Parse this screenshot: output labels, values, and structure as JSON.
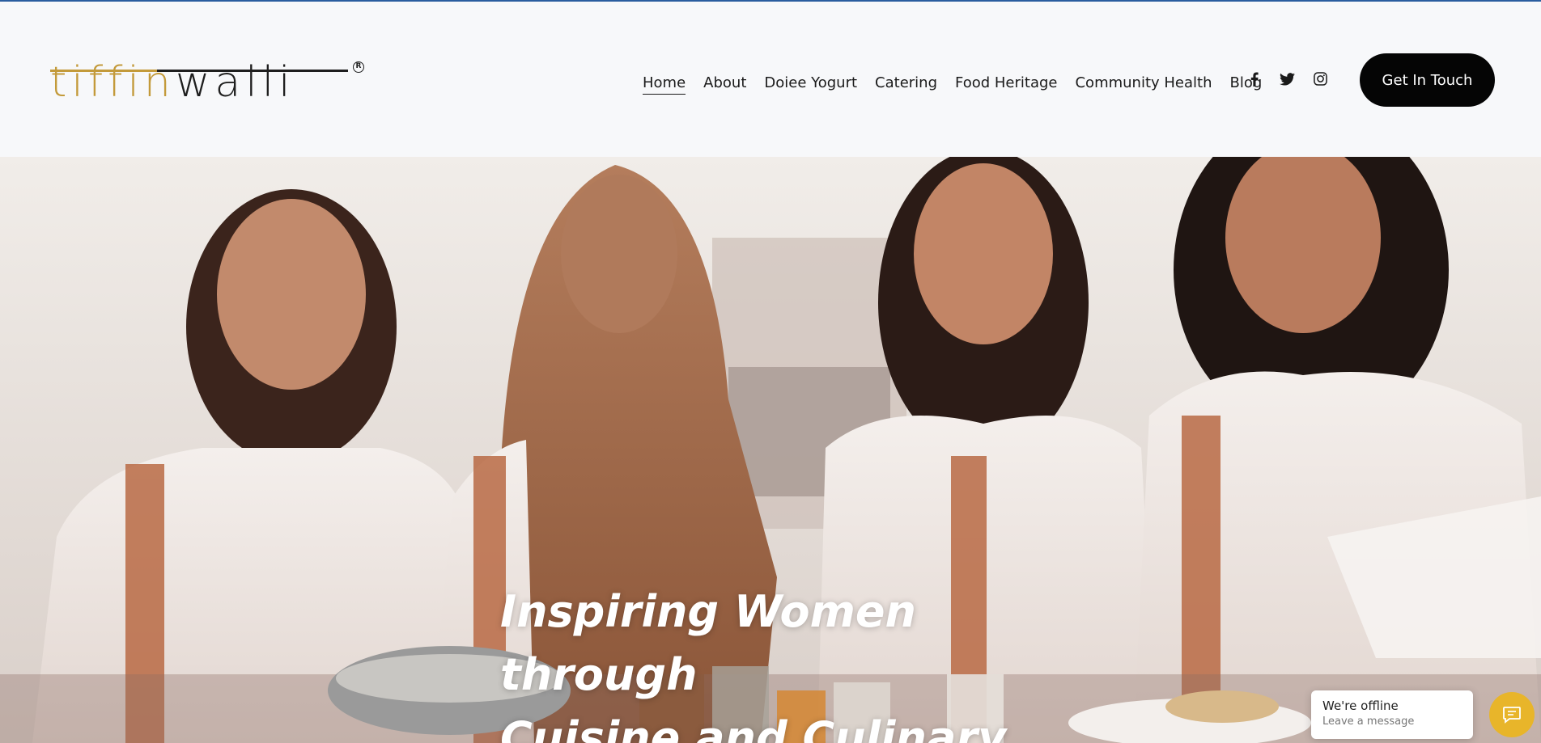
{
  "brand": {
    "name_gold": "tiffin",
    "name_dark": "walli",
    "registered_mark": "R",
    "colors": {
      "gold": "#c39a3a",
      "dark": "#1e1e1e"
    }
  },
  "nav": {
    "items": [
      {
        "label": "Home",
        "active": true
      },
      {
        "label": "About"
      },
      {
        "label": "Doiee Yogurt"
      },
      {
        "label": "Catering"
      },
      {
        "label": "Food Heritage"
      },
      {
        "label": "Community Health"
      },
      {
        "label": "Blog"
      }
    ]
  },
  "social": [
    "facebook-icon",
    "twitter-icon",
    "instagram-icon"
  ],
  "cta": {
    "label": "Get In Touch"
  },
  "hero": {
    "title_line1": "Inspiring Women through",
    "title_line2": "Cuisine and Culinary"
  },
  "chat": {
    "status": "We're offline",
    "prompt": "Leave a message",
    "accent": "#e8b52a"
  }
}
